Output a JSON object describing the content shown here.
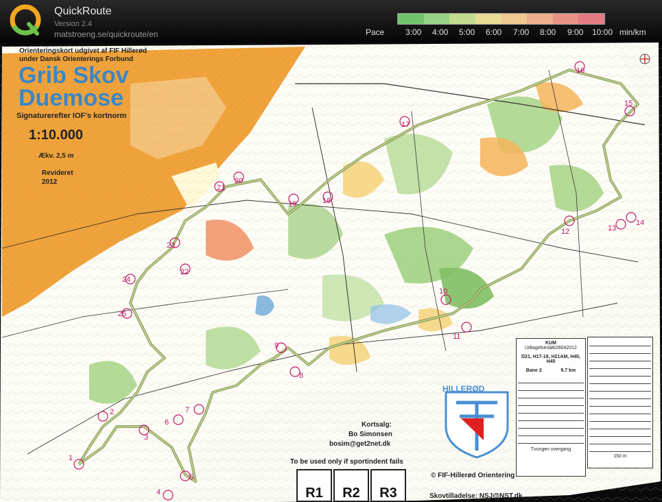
{
  "app": {
    "name": "QuickRoute",
    "version": "Version 2.4",
    "url": "matstroeng.se/quickroute/en",
    "logo_letter": "Q"
  },
  "pace": {
    "label": "Pace",
    "ticks": [
      "3:00",
      "4:00",
      "5:00",
      "6:00",
      "7:00",
      "8:00",
      "9:00",
      "10:00"
    ],
    "unit": "min/km",
    "colors": [
      "#6fc46a",
      "#95d283",
      "#c2dc8f",
      "#e8dc95",
      "#f0c890",
      "#eeae8c",
      "#e89286",
      "#e47a82"
    ]
  },
  "map": {
    "header_line1": "Orienteringskort udgivet af FIF Hillerød",
    "header_line2": "under Dansk Orienterings Forbund",
    "title_line1": "Grib Skov",
    "title_line2": "Duemose",
    "norm": "Signaturerefter IOF's kortnorm",
    "scale": "1:10.000",
    "contour": "Ækv. 2,5 m",
    "revised_label": "Revideret",
    "revised_year": "2012",
    "sales_label": "Kortsalg:",
    "sales_name": "Bo Simonsen",
    "sales_email": "bosim@get2net.dk",
    "backup_note": "To be used only if sportindent fails",
    "copyright": "© FIF-Hillerød Orientering",
    "permission": "Skovtilladelse: NSJ@NST.dk",
    "club_name": "HILLERØD",
    "r_boxes": [
      "R1",
      "R2",
      "R3"
    ],
    "desc_title": "KUM",
    "desc_event": "Udtagelsesløb28042012",
    "desc_classes": "D21, H17-18, H21AM, H40, H45",
    "desc_course": "Bane 2",
    "desc_length": "9.7 km",
    "desc_forced": "Tvungen overgang",
    "desc_finish": "150 m",
    "controls": [
      "1",
      "2",
      "3",
      "4",
      "5",
      "6",
      "7",
      "8",
      "9",
      "10",
      "11",
      "12",
      "13",
      "14",
      "15",
      "16",
      "17",
      "18",
      "19",
      "20",
      "21",
      "22",
      "23",
      "24",
      "25"
    ]
  }
}
